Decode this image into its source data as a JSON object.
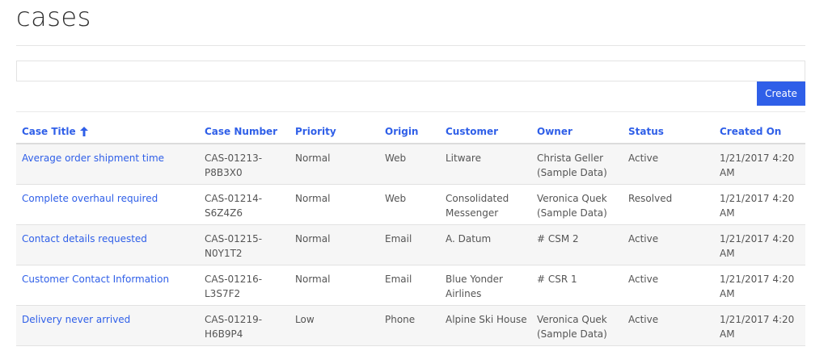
{
  "page": {
    "title": "cases"
  },
  "search": {
    "value": ""
  },
  "toolbar": {
    "create_label": "Create"
  },
  "colors": {
    "accent": "#2f5fe8",
    "header_text": "#2f5fe8",
    "row_alt": "#f6f6f6"
  },
  "table": {
    "columns": [
      {
        "label": "Case Title",
        "sort": "ascending",
        "sort_icon": "arrow-up-icon"
      },
      {
        "label": "Case Number"
      },
      {
        "label": "Priority"
      },
      {
        "label": "Origin"
      },
      {
        "label": "Customer"
      },
      {
        "label": "Owner"
      },
      {
        "label": "Status"
      },
      {
        "label": "Created On"
      }
    ],
    "rows": [
      {
        "title": "Average order shipment time",
        "number": {
          "line1": "CAS-01213-",
          "line2": "P8B3X0"
        },
        "priority": "Normal",
        "origin": "Web",
        "customer": {
          "line1": "Litware",
          "line2": ""
        },
        "owner": {
          "line1": "Christa Geller",
          "line2": "(Sample Data)"
        },
        "status": "Active",
        "created": {
          "line1": "1/21/2017 4:20",
          "line2": "AM"
        }
      },
      {
        "title": "Complete overhaul required",
        "number": {
          "line1": "CAS-01214-",
          "line2": "S6Z4Z6"
        },
        "priority": "Normal",
        "origin": "Web",
        "customer": {
          "line1": "Consolidated",
          "line2": "Messenger"
        },
        "owner": {
          "line1": "Veronica Quek",
          "line2": "(Sample Data)"
        },
        "status": "Resolved",
        "created": {
          "line1": "1/21/2017 4:20",
          "line2": "AM"
        }
      },
      {
        "title": "Contact details requested",
        "number": {
          "line1": "CAS-01215-",
          "line2": "N0Y1T2"
        },
        "priority": "Normal",
        "origin": "Email",
        "customer": {
          "line1": "A. Datum",
          "line2": ""
        },
        "owner": {
          "line1": "# CSM 2",
          "line2": ""
        },
        "status": "Active",
        "created": {
          "line1": "1/21/2017 4:20",
          "line2": "AM"
        }
      },
      {
        "title": "Customer Contact Information",
        "number": {
          "line1": "CAS-01216-",
          "line2": "L3S7F2"
        },
        "priority": "Normal",
        "origin": "Email",
        "customer": {
          "line1": "Blue Yonder",
          "line2": "Airlines"
        },
        "owner": {
          "line1": "# CSR 1",
          "line2": ""
        },
        "status": "Active",
        "created": {
          "line1": "1/21/2017 4:20",
          "line2": "AM"
        }
      },
      {
        "title": "Delivery never arrived",
        "number": {
          "line1": "CAS-01219-",
          "line2": "H6B9P4"
        },
        "priority": "Low",
        "origin": "Phone",
        "customer": {
          "line1": "Alpine Ski House",
          "line2": ""
        },
        "owner": {
          "line1": "Veronica Quek",
          "line2": "(Sample Data)"
        },
        "status": "Active",
        "created": {
          "line1": "1/21/2017 4:20",
          "line2": "AM"
        }
      }
    ]
  }
}
